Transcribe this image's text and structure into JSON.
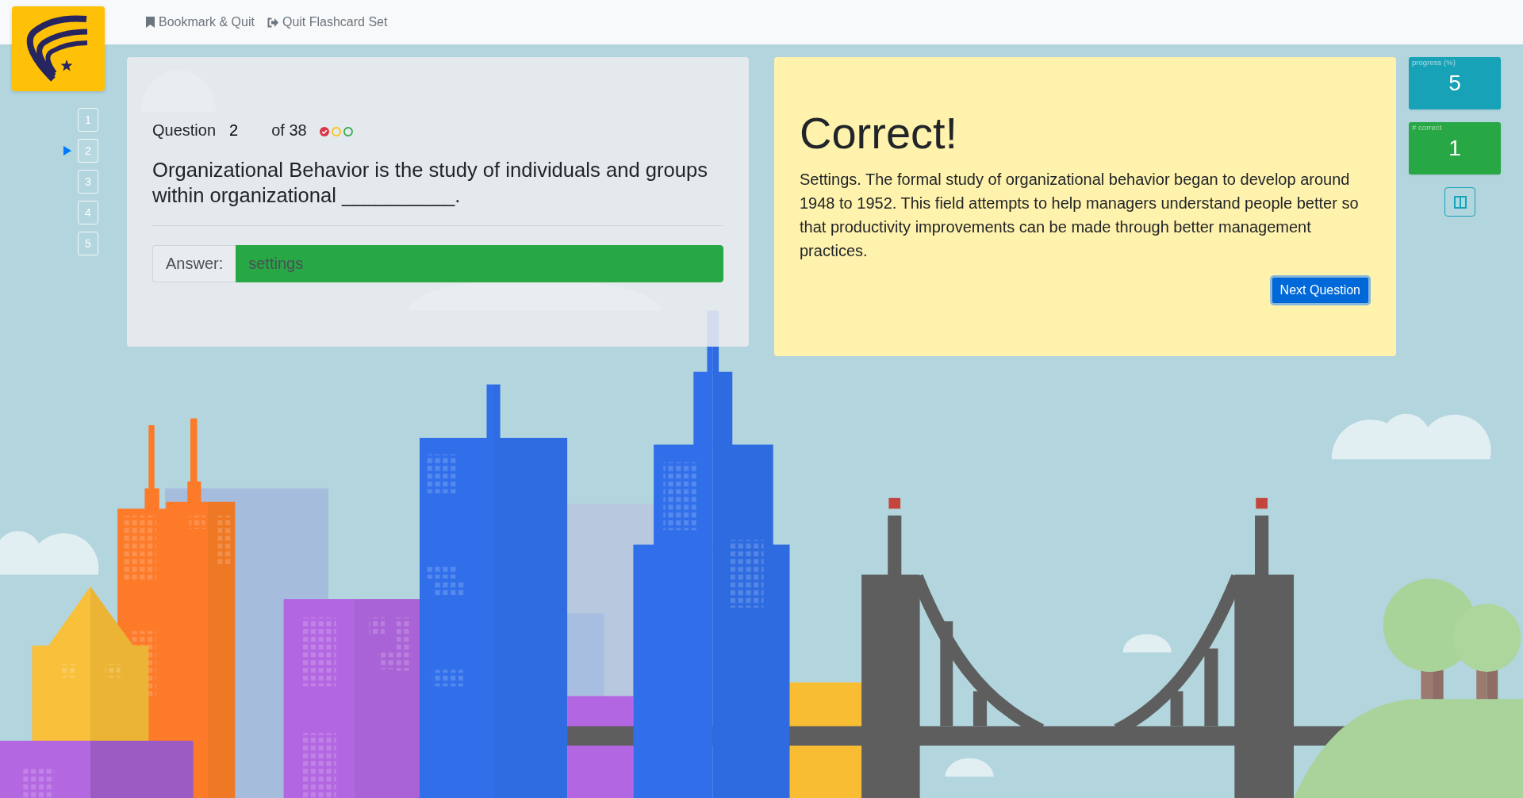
{
  "nav": {
    "links": [
      {
        "label": "Bookmark & Quit",
        "kind": "bookmark"
      },
      {
        "label": "Quit Flashcard Set",
        "kind": "quit"
      }
    ]
  },
  "question_nav": [
    {
      "label": "1",
      "selected": false
    },
    {
      "label": "2",
      "selected": true
    },
    {
      "label": "3",
      "selected": false
    },
    {
      "label": "4",
      "selected": false
    },
    {
      "label": "5",
      "selected": false
    }
  ],
  "question": {
    "label": "Question",
    "number": "2",
    "total": "of 38",
    "ratings": [
      {
        "color": "#dc3545",
        "selected": true
      },
      {
        "color": "#ffc107",
        "selected": false
      },
      {
        "color": "#28a745",
        "selected": false
      }
    ],
    "text": "Organizational Behavior is the study of individuals and groups within organizational __________.",
    "answer": {
      "label": "Answer:",
      "value": "settings",
      "correct": true
    }
  },
  "feedback": {
    "title": "Correct!",
    "text": "Settings. The formal study of organizational behavior began to develop around 1948 to 1952. This field attempts to help managers understand people better so that productivity improvements can be made through better management practices.",
    "button": "Next Question"
  },
  "stats": [
    {
      "label": "progress (%)",
      "value": "5",
      "color": "#17a2b8"
    },
    {
      "label": "# correct",
      "value": "1",
      "color": "#28a745"
    }
  ]
}
